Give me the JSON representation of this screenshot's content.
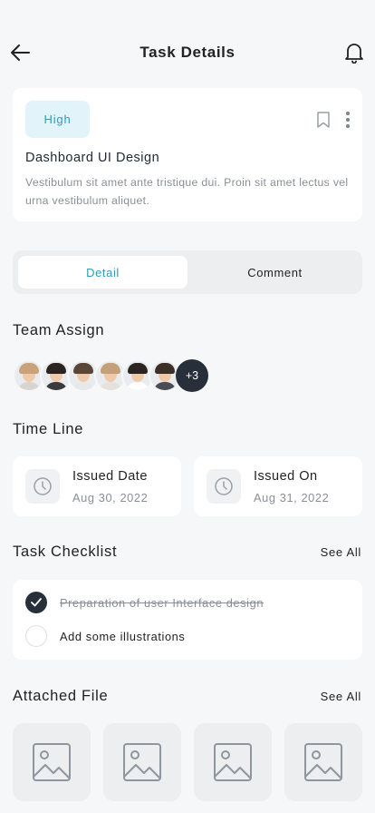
{
  "header": {
    "title": "Task Details",
    "back_icon": "arrow-left-icon",
    "notification_icon": "bell-icon"
  },
  "task": {
    "priority": "High",
    "title": "Dashboard UI Design",
    "description": "Vestibulum sit amet ante  tristique dui. Proin sit amet lectus vel urna vestibulum aliquet.",
    "bookmark_icon": "bookmark-icon",
    "menu_icon": "more-vertical-icon"
  },
  "tabs": [
    {
      "label": "Detail",
      "active": true
    },
    {
      "label": "Comment",
      "active": false
    }
  ],
  "team": {
    "title": "Team Assign",
    "members": [
      {
        "name": "member-1",
        "hair": "#c9a27a",
        "shirt": "#d9d4cf"
      },
      {
        "name": "member-2",
        "hair": "#2a2320",
        "shirt": "#3b3a3d"
      },
      {
        "name": "member-3",
        "hair": "#5a4636",
        "shirt": "#e8e8e8"
      },
      {
        "name": "member-4",
        "hair": "#c4a07a",
        "shirt": "#e5e1dc"
      },
      {
        "name": "member-5",
        "hair": "#2b2522",
        "shirt": "#ffffff"
      },
      {
        "name": "member-6",
        "hair": "#3b2f28",
        "shirt": "#4a4d55"
      }
    ],
    "more_count": "+3"
  },
  "timeline": {
    "title": "Time Line",
    "issued": {
      "label": "Issued Date",
      "value": "Aug 30, 2022",
      "icon": "clock-icon"
    },
    "issued_on": {
      "label": "Issued On",
      "value": "Aug 31, 2022",
      "icon": "clock-icon"
    }
  },
  "checklist": {
    "title": "Task Checklist",
    "see_all": "See All",
    "items": [
      {
        "text": "Preparation of user Interface design",
        "done": true
      },
      {
        "text": "Add some illustrations",
        "done": false
      }
    ]
  },
  "attachments": {
    "title": "Attached File",
    "see_all": "See All",
    "files": [
      "image-icon",
      "image-icon",
      "image-icon",
      "image-icon"
    ]
  },
  "colors": {
    "accent": "#2e9cbf",
    "dark": "#27303a",
    "background": "#f6f7f8"
  }
}
